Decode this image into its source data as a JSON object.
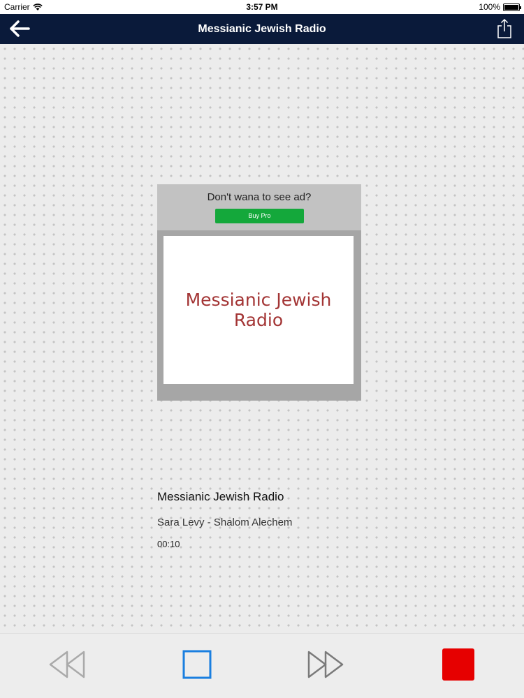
{
  "status_bar": {
    "carrier": "Carrier",
    "time": "3:57 PM",
    "battery": "100%",
    "battery_level_percent": 100
  },
  "nav": {
    "title": "Messianic Jewish Radio",
    "back_icon": "arrow-left-icon",
    "share_icon": "share-icon"
  },
  "ad": {
    "prompt": "Don't wana to see ad?",
    "buy_button": "Buy Pro",
    "buy_button_color": "#14a83b",
    "logo_line1": "Messianic Jewish",
    "logo_line2": "Radio",
    "logo_color": "#a33535"
  },
  "now_playing": {
    "station": "Messianic Jewish Radio",
    "track": "Sara Levy - Shalom Alechem",
    "elapsed": "00:10"
  },
  "toolbar": {
    "rewind_icon": "rewind-icon",
    "stop_outline_icon": "stop-outline-icon",
    "forward_icon": "fast-forward-icon",
    "stop_icon": "stop-icon",
    "accent_blue": "#1a7fe0",
    "stop_red": "#e60000"
  },
  "colors": {
    "nav_background": "#0a1a3a",
    "page_background": "#ececec"
  }
}
